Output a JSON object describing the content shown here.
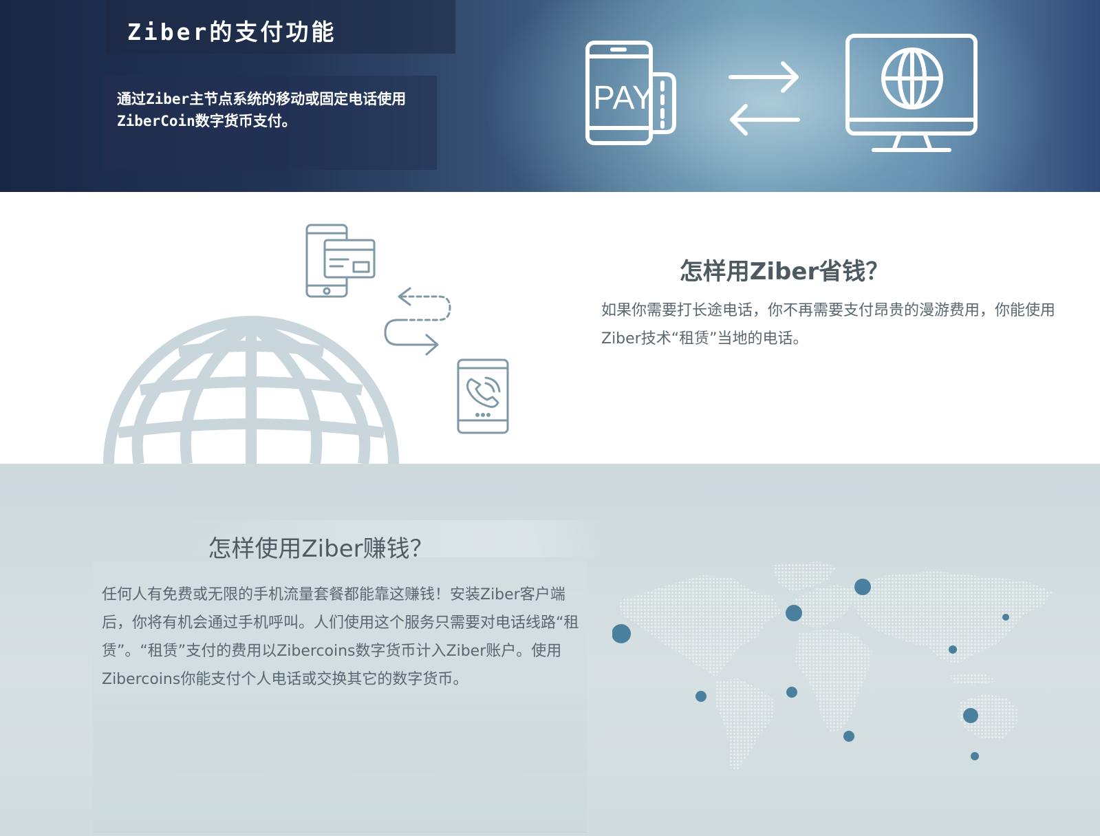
{
  "hero": {
    "title": "Ziber的支付功能",
    "description": "通过Ziber主节点系统的移动或固定电话使用ZiberCoin数字货币支付。",
    "pay_label": "PAY"
  },
  "save_section": {
    "heading": "怎样用Ziber省钱？",
    "text": "如果你需要打长途电话，你不再需要支付昂贵的漫游费用，你能使用Ziber技术“租赁”当地的电话。"
  },
  "earn_section": {
    "heading": "怎样使用Ziber赚钱？",
    "text": "任何人有免费或无限的手机流量套餐都能靠这赚钱！安装Ziber客户端后，你将有机会通过手机呼叫。人们使用这个服务只需要对电话线路“租赁”。“租赁”支付的费用以Zibercoins数字货币计入Ziber账户。使用Zibercoins你能支付个人电话或交换其它的数字货币。"
  },
  "colors": {
    "hero_dark": "#192746",
    "hero_light": "#6e9ab5",
    "icon_line": "#7e98a6",
    "globe": "#c9d6dc",
    "earn_bg": "#cdd9dc",
    "map_dot": "#e9eff1",
    "map_marker": "#4b7f9e"
  }
}
